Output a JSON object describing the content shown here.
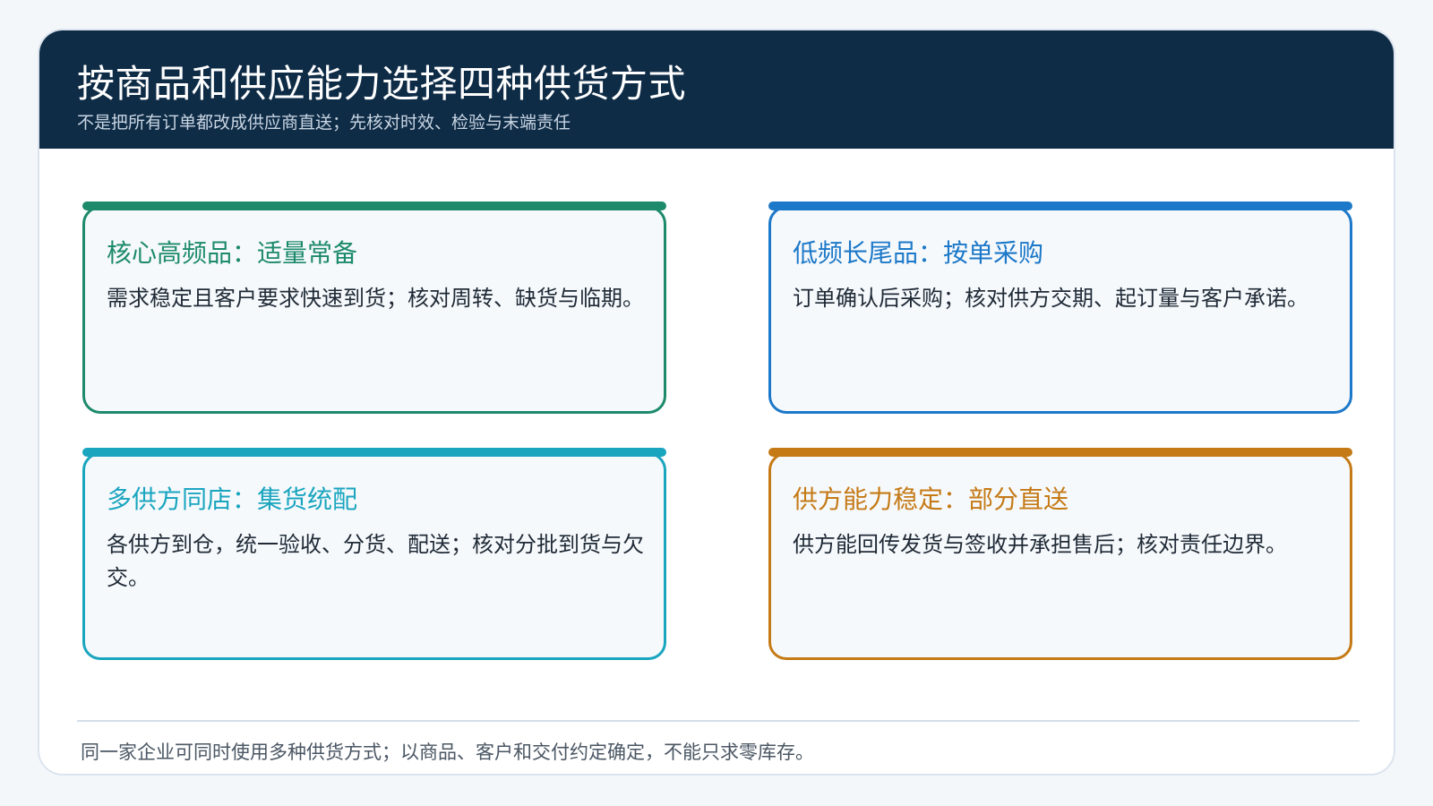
{
  "header": {
    "title": "按商品和供应能力选择四种供货方式",
    "subtitle": "不是把所有订单都改成供应商直送；先核对时效、检验与末端责任"
  },
  "cards": [
    {
      "title": "核心高频品：适量常备",
      "body": "需求稳定且客户要求快速到货；核对周转、缺货与临期。",
      "color": "#1d8a6c"
    },
    {
      "title": "低频长尾品：按单采购",
      "body": "订单确认后采购；核对供方交期、起订量与客户承诺。",
      "color": "#1c78c8"
    },
    {
      "title": "多供方同店：集货统配",
      "body": "各供方到仓，统一验收、分货、配送；核对分批到货与欠交。",
      "color": "#1aa5bf"
    },
    {
      "title": "供方能力稳定：部分直送",
      "body": "供方能回传发货与签收并承担售后；核对责任边界。",
      "color": "#c57a16"
    }
  ],
  "footer": {
    "note": "同一家企业可同时使用多种供货方式；以商品、客户和交付约定确定，不能只求零库存。"
  },
  "colors": {
    "header_bg": "#0f2c47",
    "card_bg": "#f6f9fc"
  }
}
